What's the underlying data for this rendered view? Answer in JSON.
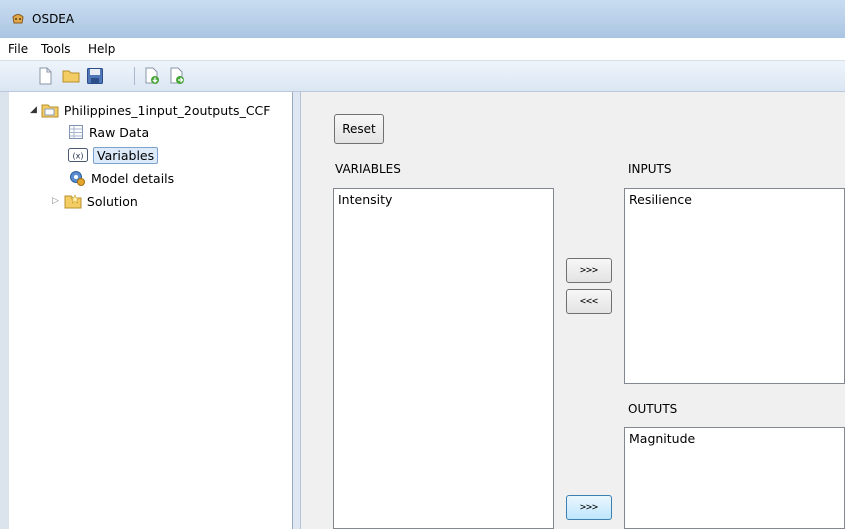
{
  "window": {
    "title": "OSDEA"
  },
  "menu": {
    "file": "File",
    "tools": "Tools",
    "help": "Help"
  },
  "tree": {
    "root": "Philippines_1input_2outputs_CCF",
    "raw_data": "Raw Data",
    "variables": "Variables",
    "model_details": "Model details",
    "solution": "Solution"
  },
  "panel": {
    "reset": "Reset",
    "variables_header": "VARIABLES",
    "inputs_header": "INPUTS",
    "outputs_header": "OUTUTS",
    "variables_items": [
      "Intensity"
    ],
    "inputs_items": [
      "Resilience"
    ],
    "outputs_items": [
      "Magnitude"
    ],
    "add_input": ">>>",
    "remove_input": "<<<",
    "add_output": ">>>"
  }
}
